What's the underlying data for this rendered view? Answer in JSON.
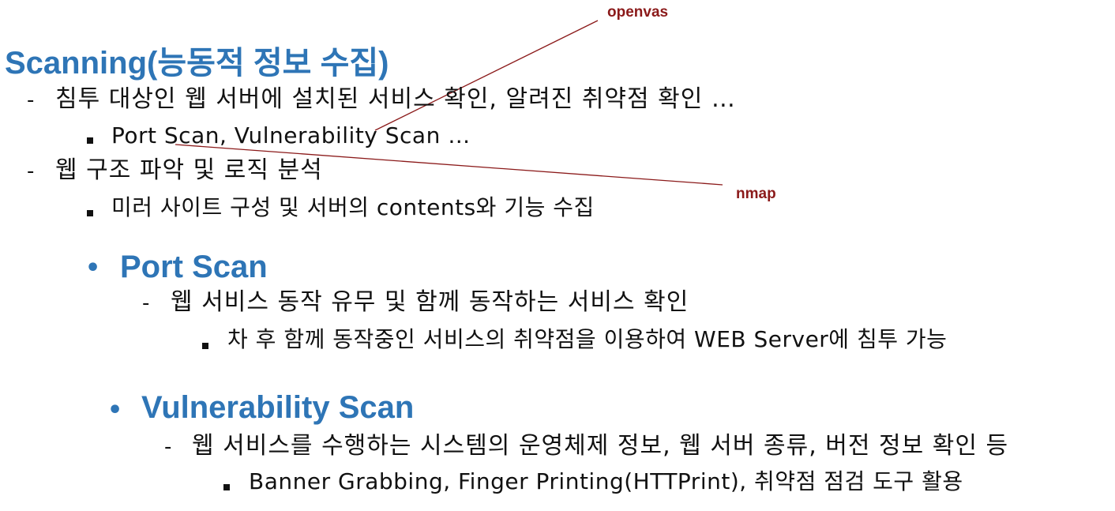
{
  "title": "Scanning(능동적 정보 수집)",
  "annotations": {
    "top": "openvas",
    "right": "nmap"
  },
  "intro": {
    "item1": "침투 대상인 웹 서버에 설치된 서비스 확인, 알려진 취약점 확인 …",
    "item1_sub": "Port Scan, Vulnerability Scan …",
    "item2": "웹 구조 파악 및 로직 분석",
    "item2_sub": "미러 사이트 구성 및 서버의 contents와 기능 수집"
  },
  "port_scan": {
    "heading": "Port Scan",
    "item": "웹 서비스 동작 유무 및 함께 동작하는 서비스 확인",
    "sub": "차 후 함께 동작중인 서비스의 취약점을 이용하여 WEB Server에 침투 가능"
  },
  "vuln_scan": {
    "heading": "Vulnerability Scan",
    "item": "웹 서비스를 수행하는 시스템의 운영체제 정보, 웹 서버 종류, 버전 정보 확인 등",
    "sub": "Banner Grabbing, Finger Printing(HTTPrint), 취약점 점검 도구 활용"
  },
  "colors": {
    "heading": "#2e75b6",
    "annotation": "#8b1a1a",
    "line": "#8b1a1a"
  }
}
